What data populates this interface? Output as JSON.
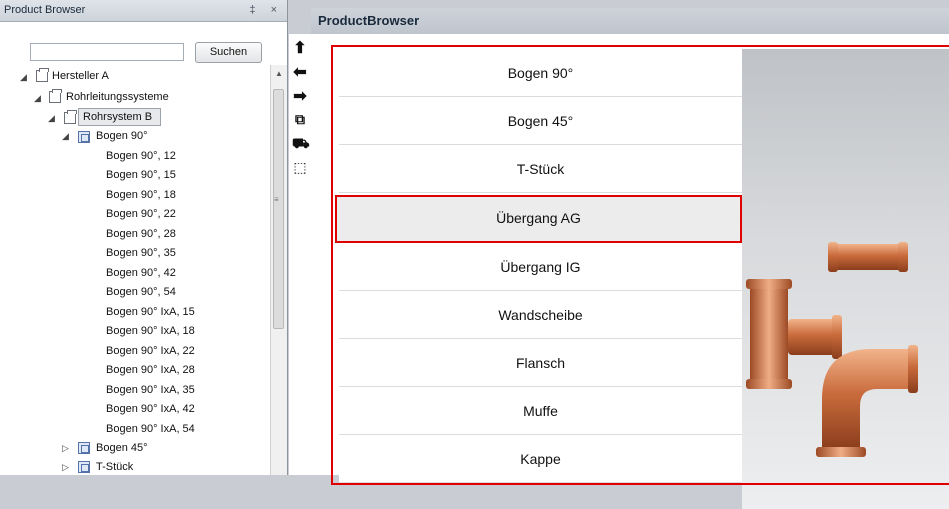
{
  "left_panel": {
    "title": "Product Browser",
    "controls": "‡ ×",
    "search_placeholder": "",
    "search_button": "Suchen",
    "tree": {
      "root": "Hersteller A",
      "level1": "Rohrleitungssysteme",
      "level2": "Rohrsystem B",
      "level3": "Bogen 90°",
      "items": [
        "Bogen 90°, 12",
        "Bogen 90°, 15",
        "Bogen 90°, 18",
        "Bogen 90°, 22",
        "Bogen 90°, 28",
        "Bogen 90°, 35",
        "Bogen 90°, 42",
        "Bogen 90°, 54",
        "Bogen 90° IxA, 15",
        "Bogen 90° IxA, 18",
        "Bogen 90° IxA, 22",
        "Bogen 90° IxA, 28",
        "Bogen 90° IxA, 35",
        "Bogen 90° IxA, 42",
        "Bogen 90° IxA, 54"
      ],
      "siblings": [
        "Bogen 45°",
        "T-Stück"
      ]
    }
  },
  "toolbar": {
    "icons": [
      "arrow-up-icon",
      "arrow-left-icon",
      "arrow-right-icon",
      "open-external-icon",
      "cart-icon",
      "selection-icon"
    ]
  },
  "main": {
    "title": "ProductBrowser",
    "rows": [
      "Bogen 90°",
      "Bogen 45°",
      "T-Stück",
      "Übergang AG",
      "Übergang IG",
      "Wandscheibe",
      "Flansch",
      "Muffe",
      "Kappe"
    ],
    "active_row": "Übergang AG",
    "accent_color": "#e00000",
    "image": "copper-pipe-fittings"
  }
}
